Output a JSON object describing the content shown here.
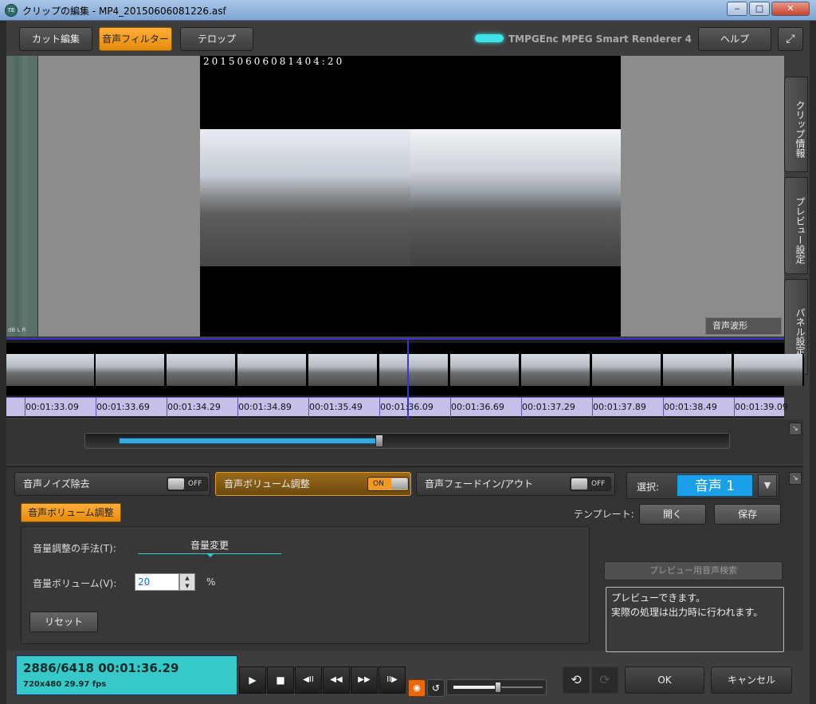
{
  "window": {
    "title": "クリップの編集 - MP4_20150606081226.asf",
    "minimize": "‒",
    "maximize": "□",
    "close": "✕"
  },
  "topbar": {
    "cut_edit": "カット編集",
    "audio_filter": "音声フィルター",
    "telop": "テロップ",
    "brand": "TMPGEnc MPEG Smart Renderer 4",
    "help": "ヘルプ"
  },
  "video": {
    "timestamp": "20150606081404:20"
  },
  "meter": {
    "labels": "dB L R"
  },
  "side_tabs": {
    "clip_info": "クリップ情報",
    "preview_settings": "プレビュー設定",
    "panel_settings": "パネル設定",
    "waveform": "音声波形"
  },
  "timeline": {
    "timecodes": [
      "00:01:33.09",
      "00:01:33.69",
      "00:01:34.29",
      "00:01:34.89",
      "00:01:35.49",
      "00:01:36.09",
      "00:01:36.69",
      "00:01:37.29",
      "00:01:37.89",
      "00:01:38.49",
      "00:01:39.09"
    ]
  },
  "seek": {
    "position_fraction": 0.45
  },
  "filters": {
    "noise": {
      "label": "音声ノイズ除去",
      "state": "OFF"
    },
    "volume": {
      "label": "音声ボリューム調整",
      "state": "ON"
    },
    "fade": {
      "label": "音声フェードイン/アウト",
      "state": "OFF"
    },
    "select_label": "選択:",
    "select_value": "音声 1"
  },
  "volume_panel": {
    "section_label": "音声ボリューム調整",
    "template_label": "テンプレート:",
    "open": "開く",
    "save": "保存",
    "method_label": "音量調整の手法(T):",
    "method_value": "音量変更",
    "volume_label": "音量ボリューム(V):",
    "volume_value": "20",
    "unit": "%",
    "reset": "リセット",
    "preview_search": "プレビュー用音声検索",
    "message_line1": "プレビューできます。",
    "message_line2": "実際の処理は出力時に行われます。"
  },
  "status": {
    "frame": "2886/6418 00:01:36.29",
    "format": "720x480 29.97 fps"
  },
  "playback": {
    "play": "▶",
    "stop": "■",
    "prev_frame": "◀II",
    "rewind": "◀◀",
    "forward": "▶▶",
    "next_frame": "II▶",
    "volume_level": 0.5
  },
  "buttons": {
    "ok": "OK",
    "cancel": "キャンセル"
  },
  "colors": {
    "accent_orange": "#f29a1f",
    "selection_blue": "#1aa0e8",
    "status_cyan": "#37c8c8",
    "timeline_purple": "#c6bfea"
  }
}
